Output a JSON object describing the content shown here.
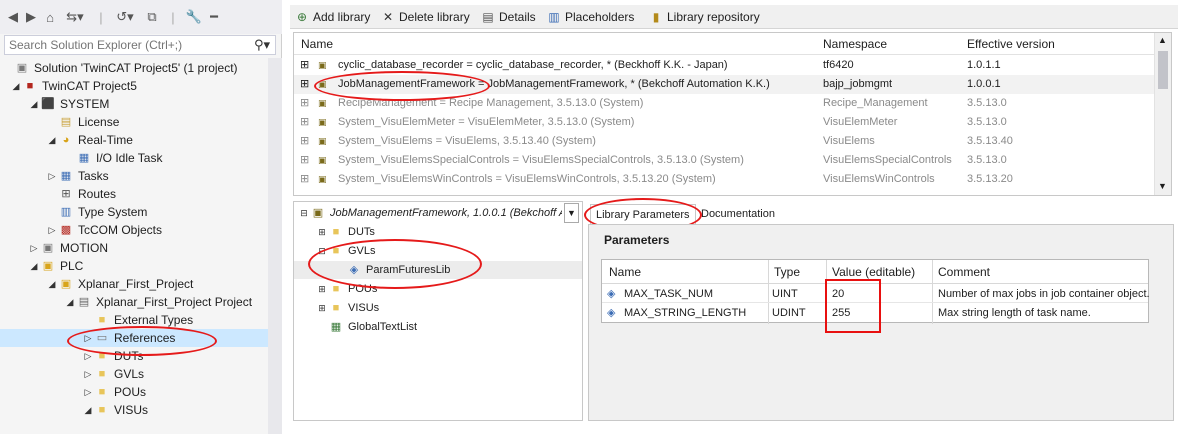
{
  "solution_explorer": {
    "search_placeholder": "Search Solution Explorer (Ctrl+;)",
    "tree": [
      {
        "label": "Solution 'TwinCAT Project5' (1 project)"
      },
      {
        "label": "TwinCAT Project5"
      },
      {
        "label": "SYSTEM"
      },
      {
        "label": "License"
      },
      {
        "label": "Real-Time"
      },
      {
        "label": "I/O Idle Task"
      },
      {
        "label": "Tasks"
      },
      {
        "label": "Routes"
      },
      {
        "label": "Type System"
      },
      {
        "label": "TcCOM Objects"
      },
      {
        "label": "MOTION"
      },
      {
        "label": "PLC"
      },
      {
        "label": "Xplanar_First_Project"
      },
      {
        "label": "Xplanar_First_Project Project"
      },
      {
        "label": "External Types"
      },
      {
        "label": "References"
      },
      {
        "label": "DUTs"
      },
      {
        "label": "GVLs"
      },
      {
        "label": "POUs"
      },
      {
        "label": "VISUs"
      }
    ]
  },
  "toolbar": {
    "add_library": "Add library",
    "delete_library": "Delete library",
    "details": "Details",
    "placeholders": "Placeholders",
    "library_repository": "Library repository"
  },
  "library_list": {
    "headers": {
      "name": "Name",
      "namespace": "Namespace",
      "version": "Effective version"
    },
    "rows": [
      {
        "name": "cyclic_database_recorder = cyclic_database_recorder, * (Beckhoff K.K. - Japan)",
        "namespace": "tf6420",
        "version": "1.0.1.1"
      },
      {
        "name": "JobManagementFramework = JobManagementFramework, * (Bekchoff Automation K.K.)",
        "namespace": "bajp_jobmgmt",
        "version": "1.0.0.1"
      },
      {
        "name": "RecipeManagement = Recipe Management, 3.5.13.0 (System)",
        "namespace": "Recipe_Management",
        "version": "3.5.13.0"
      },
      {
        "name": "System_VisuElemMeter = VisuElemMeter, 3.5.13.0 (System)",
        "namespace": "VisuElemMeter",
        "version": "3.5.13.0"
      },
      {
        "name": "System_VisuElems = VisuElems, 3.5.13.40 (System)",
        "namespace": "VisuElems",
        "version": "3.5.13.40"
      },
      {
        "name": "System_VisuElemsSpecialControls = VisuElemsSpecialControls, 3.5.13.0 (System)",
        "namespace": "VisuElemsSpecialControls",
        "version": "3.5.13.0"
      },
      {
        "name": "System_VisuElemsWinControls = VisuElemsWinControls, 3.5.13.20 (System)",
        "namespace": "VisuElemsWinControls",
        "version": "3.5.13.20"
      }
    ]
  },
  "library_tree": {
    "root": "JobManagementFramework, 1.0.0.1 (Bekchoff A",
    "items": [
      "DUTs",
      "GVLs",
      "ParamFuturesLib",
      "POUs",
      "VISUs",
      "GlobalTextList"
    ]
  },
  "tabs": {
    "library_parameters": "Library Parameters",
    "documentation": "Documentation"
  },
  "parameters": {
    "title": "Parameters",
    "headers": {
      "name": "Name",
      "type": "Type",
      "value": "Value (editable)",
      "comment": "Comment"
    },
    "rows": [
      {
        "name": "MAX_TASK_NUM",
        "type": "UINT",
        "value": "20",
        "comment": "Number of max jobs in job container object."
      },
      {
        "name": "MAX_STRING_LENGTH",
        "type": "UDINT",
        "value": "255",
        "comment": "Max string length of task name."
      }
    ]
  },
  "colors": {
    "selection": "#cce8ff",
    "highlight": "#e51a1a",
    "folder": "#e8c55a"
  }
}
